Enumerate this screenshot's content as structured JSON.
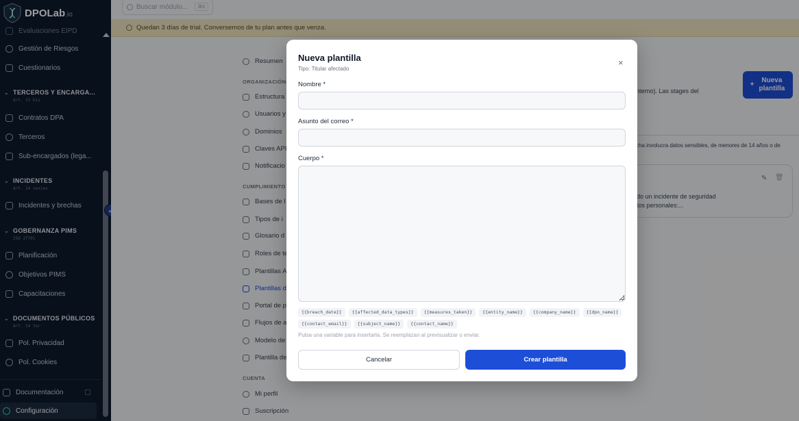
{
  "brand": {
    "name": "DPOLab",
    "suffix": ".io"
  },
  "search": {
    "placeholder": "Buscar módulo...",
    "shortcut": "⌘K"
  },
  "trial_banner": "Quedan 3 días de trial. Conversemos de tu plan antes que venza.",
  "sidebar": {
    "partial_top": "Evaluaciones EIPD",
    "items_top": [
      "Gestión de Riesgos",
      "Cuestionarios"
    ],
    "sections": [
      {
        "title": "TERCEROS Y ENCARGA...",
        "sub": "Art. 15 bis",
        "items": [
          "Contratos DPA",
          "Terceros",
          "Sub-encargados (lega..."
        ]
      },
      {
        "title": "INCIDENTES",
        "sub": "Art. 14 sexies",
        "items": [
          "Incidentes y brechas"
        ]
      },
      {
        "title": "GOBERNANZA PIMS",
        "sub": "ISO 27701",
        "items": [
          "Planificación",
          "Objetivos PIMS",
          "Capacitaciones"
        ]
      },
      {
        "title": "DOCUMENTOS PÚBLICOS",
        "sub": "Art. 14 ter",
        "items": [
          "Pol. Privacidad",
          "Pol. Cookies"
        ]
      }
    ],
    "footer": {
      "docs": "Documentación",
      "config": "Configuración"
    },
    "collapse_glyph": "«"
  },
  "settings_nav": {
    "resumen": "Resumen",
    "org_title": "ORGANIZACIÓN",
    "org_items": [
      "Estructura",
      "Usuarios y",
      "Dominios",
      "Claves API",
      "Notificacio"
    ],
    "cumplimiento_title": "CUMPLIMIENTO",
    "cumplimiento_items": [
      "Bases de l",
      "Tipos de i",
      "Glosario d",
      "Roles de te",
      "Plantillas A",
      "Plantillas d",
      "Portal de p",
      "Flujos de a",
      "Modelo de",
      "Plantilla de"
    ],
    "cuenta_title": "CUENTA",
    "cuenta_items": [
      "Mi perfil",
      "Suscripción"
    ]
  },
  "background": {
    "desc_right": "interno). Las stages del",
    "new_button": "Nueva plantilla",
    "row_text": "cha involucra datos sensibles, de menores de 14 años o de",
    "card_line1": "do un incidente de seguridad",
    "card_line2": "tos personales:..."
  },
  "modal": {
    "title": "Nueva plantilla",
    "subtitle": "Tipo: Titular afectado",
    "close_glyph": "×",
    "name_label": "Nombre *",
    "name_value": "",
    "subject_label": "Asunto del correo *",
    "subject_value": "",
    "body_label": "Cuerpo *",
    "body_value": "",
    "variables": [
      "{{breach_date}}",
      "{{affected_data_types}}",
      "{{measures_taken}}",
      "{{entity_name}}",
      "{{company_name}}",
      "{{dpo_name}}",
      "{{contact_email}}",
      "{{subject_name}}",
      "{{contact_name}}"
    ],
    "hint": "Pulsa una variable para insertarla. Se reemplazan al previsualizar o enviar.",
    "cancel": "Cancelar",
    "create": "Crear plantilla"
  },
  "colors": {
    "sidebar_bg": "#0d1b2e",
    "primary": "#1d4ed8",
    "trial_bg": "#efe5c4"
  }
}
